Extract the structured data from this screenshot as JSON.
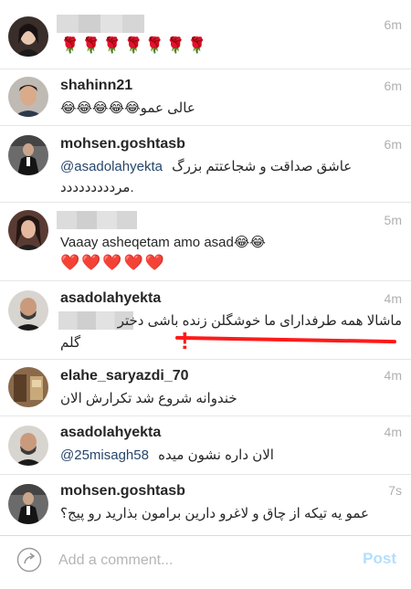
{
  "comments": [
    {
      "username": "",
      "time": "6m",
      "text": "🌹🌹🌹🌹🌹🌹🌹"
    },
    {
      "username": "shahinn21",
      "time": "6m",
      "text": "عالی عمو😂😂😂😂😂"
    },
    {
      "username": "mohsen.goshtasb",
      "time": "6m",
      "mention": "@asadolahyekta",
      "text": "عاشق صداقت و شجاعتتم بزرگ",
      "text2": "مرددددددددد."
    },
    {
      "username": "",
      "time": "5m",
      "text": "Vaaay asheqetam amo asad😂😂",
      "text2": "❤️❤️❤️❤️❤️"
    },
    {
      "username": "asadolahyekta",
      "time": "4m",
      "text": "ماشالا همه طرفدارای ما خوشگلن زنده باشی دختر",
      "text2": "گلم"
    },
    {
      "username": "elahe_saryazdi_70",
      "time": "4m",
      "text": "خندوانه شروع شد تکرارش الان"
    },
    {
      "username": "asadolahyekta",
      "time": "4m",
      "mention": "@25misagh58",
      "text": "الان داره نشون میده"
    },
    {
      "username": "mohsen.goshtasb",
      "time": "7s",
      "text": "عمو یه تیکه از چاق و لاغرو دارین برامون بذارید رو پیج؟"
    }
  ],
  "annotation": {
    "mark": "!"
  },
  "composer": {
    "placeholder": "Add a comment...",
    "post_label": "Post"
  },
  "colors": {
    "annotation": "#ff1a1a",
    "mention": "#27466b",
    "post_disabled": "#b2dffc"
  }
}
